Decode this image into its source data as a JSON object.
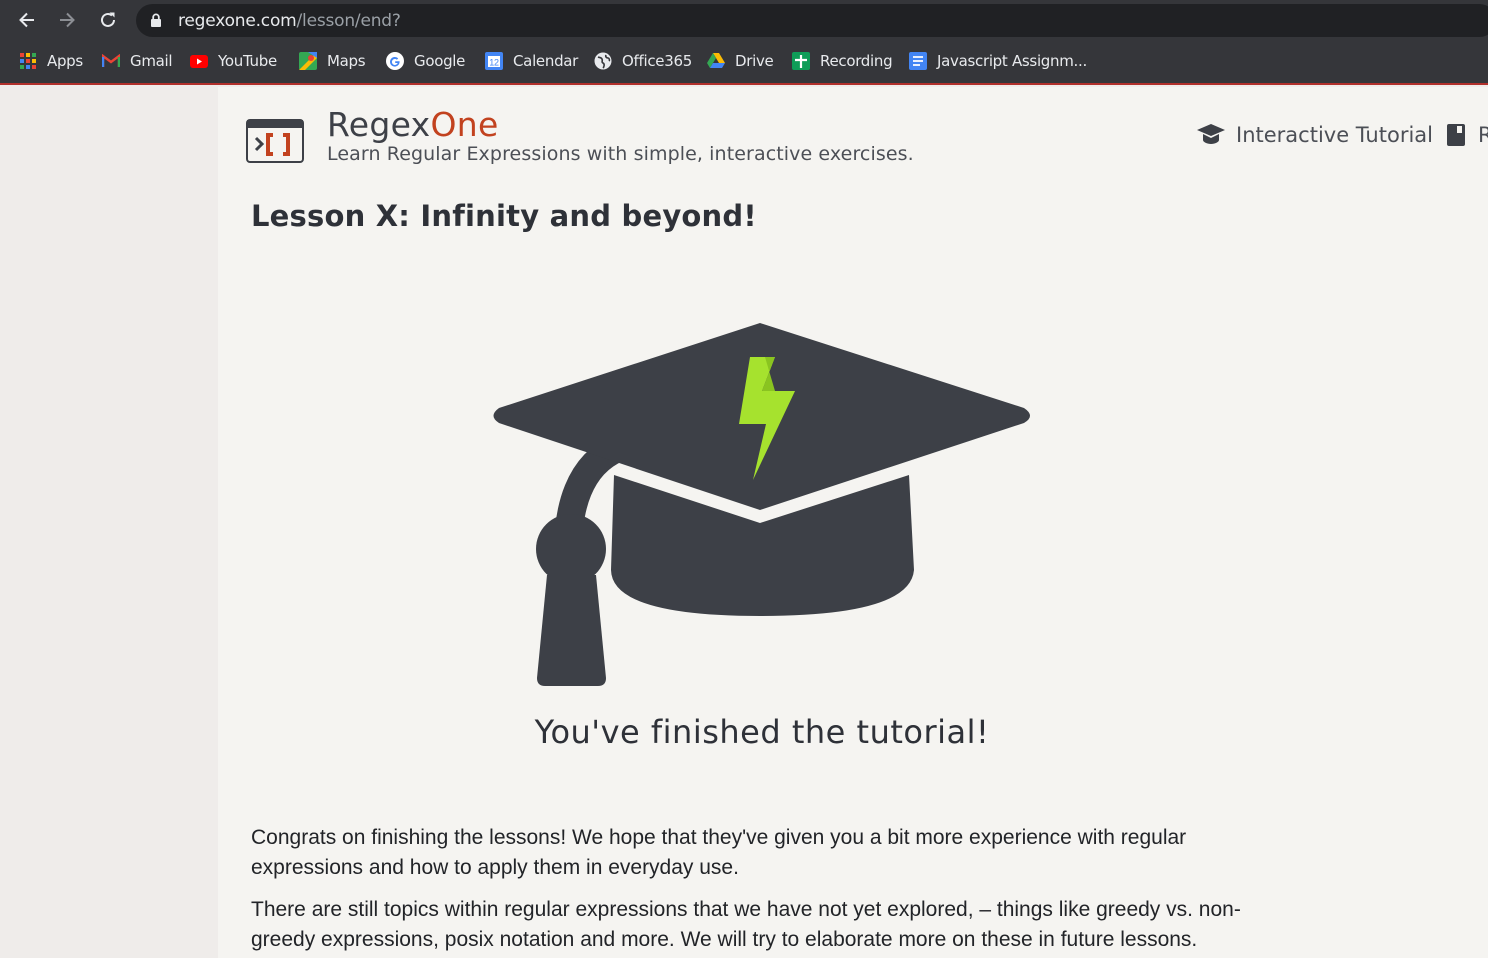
{
  "browser": {
    "url_host": "regexone.com",
    "url_path": "/lesson/end?",
    "bookmarks": [
      {
        "label": "Apps",
        "icon": "apps-grid-icon"
      },
      {
        "label": "Gmail",
        "icon": "gmail-icon"
      },
      {
        "label": "YouTube",
        "icon": "youtube-icon"
      },
      {
        "label": "Maps",
        "icon": "maps-icon"
      },
      {
        "label": "Google",
        "icon": "google-icon"
      },
      {
        "label": "Calendar",
        "icon": "calendar-icon"
      },
      {
        "label": "Office365",
        "icon": "globe-icon"
      },
      {
        "label": "Drive",
        "icon": "drive-icon"
      },
      {
        "label": "Recording",
        "icon": "sheets-icon"
      },
      {
        "label": "Javascript Assignm...",
        "icon": "docs-icon"
      }
    ],
    "calendar_day": "12"
  },
  "site": {
    "brand_main": "Regex",
    "brand_accent": "One",
    "tagline": "Learn Regular Expressions with simple, interactive exercises.",
    "nav": [
      {
        "label": "Interactive Tutorial",
        "icon": "graduation-cap-icon"
      },
      {
        "label": "R",
        "icon": "book-icon"
      }
    ],
    "colors": {
      "accent": "#c2421f",
      "text": "#2e3138",
      "lightning": "#a6e22e"
    }
  },
  "lesson": {
    "title": "Lesson X: Infinity and beyond!",
    "finished": "You've finished the tutorial!",
    "paragraphs": [
      "Congrats on finishing the lessons! We hope that they've given you a bit more experience with regular expressions and how to apply them in everyday use.",
      "There are still topics within regular expressions that we have not yet explored, – things like greedy vs. non-greedy expressions, posix notation and more. We will try to elaborate more on these in future lessons."
    ]
  }
}
